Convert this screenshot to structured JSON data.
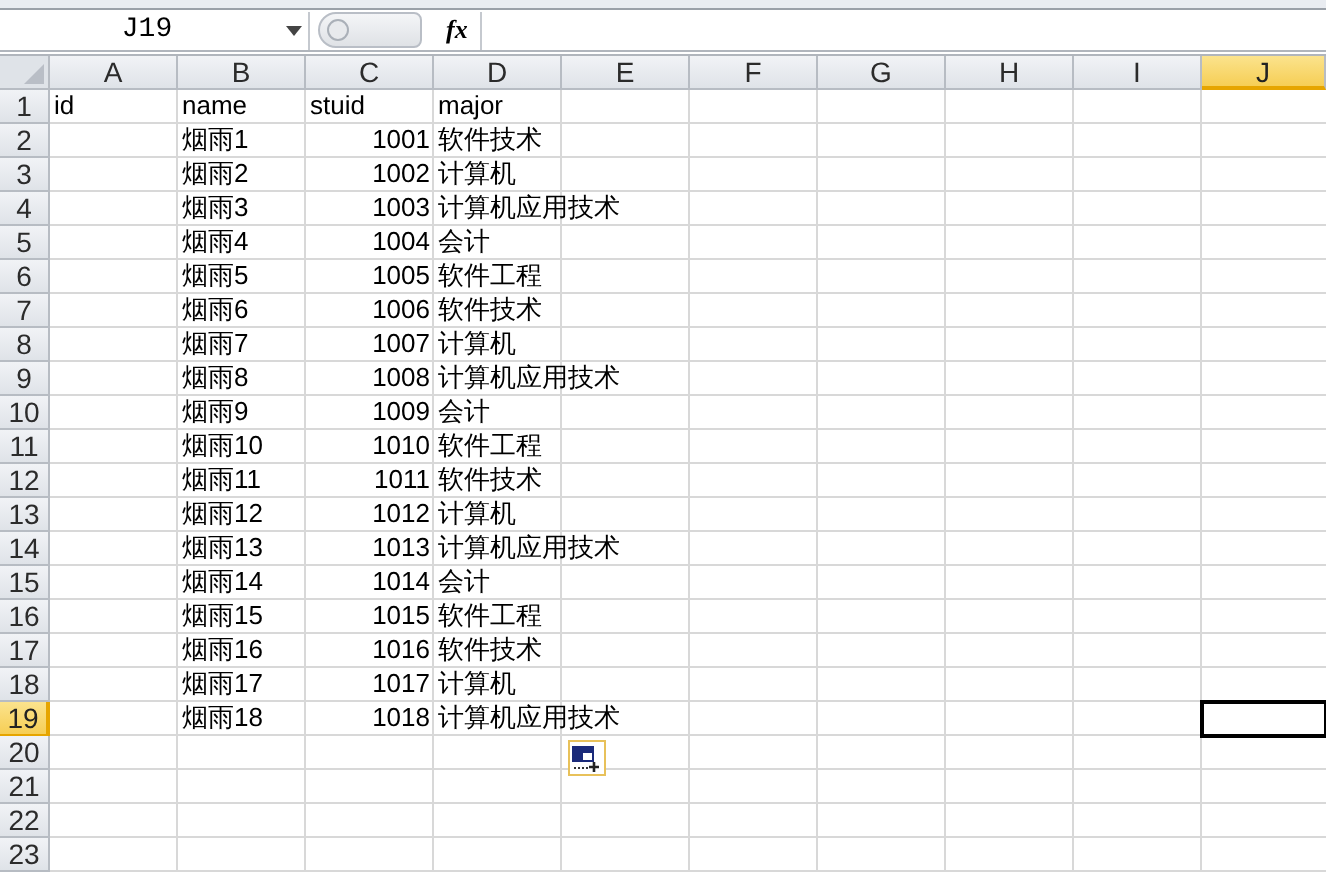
{
  "formula_bar": {
    "name_box": "J19",
    "function_button": "fx"
  },
  "columns": [
    {
      "label": "A",
      "selected": false
    },
    {
      "label": "B",
      "selected": false
    },
    {
      "label": "C",
      "selected": false
    },
    {
      "label": "D",
      "selected": false
    },
    {
      "label": "E",
      "selected": false
    },
    {
      "label": "F",
      "selected": false
    },
    {
      "label": "G",
      "selected": false
    },
    {
      "label": "H",
      "selected": false
    },
    {
      "label": "I",
      "selected": false
    },
    {
      "label": "J",
      "selected": true
    }
  ],
  "rows": [
    {
      "number": "1",
      "selected": false,
      "cells": [
        {
          "text": "id",
          "kind": "text"
        },
        {
          "text": "name",
          "kind": "text"
        },
        {
          "text": "stuid",
          "kind": "text"
        },
        {
          "text": "major",
          "kind": "text"
        }
      ]
    },
    {
      "number": "2",
      "selected": false,
      "cells": [
        null,
        {
          "text": "烟雨1",
          "kind": "text"
        },
        {
          "text": "1001",
          "kind": "number"
        },
        {
          "text": "软件技术",
          "kind": "text"
        }
      ]
    },
    {
      "number": "3",
      "selected": false,
      "cells": [
        null,
        {
          "text": "烟雨2",
          "kind": "text"
        },
        {
          "text": "1002",
          "kind": "number"
        },
        {
          "text": "计算机",
          "kind": "text"
        }
      ]
    },
    {
      "number": "4",
      "selected": false,
      "cells": [
        null,
        {
          "text": "烟雨3",
          "kind": "text"
        },
        {
          "text": "1003",
          "kind": "number"
        },
        {
          "text": "计算机应用技术",
          "kind": "text"
        }
      ]
    },
    {
      "number": "5",
      "selected": false,
      "cells": [
        null,
        {
          "text": "烟雨4",
          "kind": "text"
        },
        {
          "text": "1004",
          "kind": "number"
        },
        {
          "text": "会计",
          "kind": "text"
        }
      ]
    },
    {
      "number": "6",
      "selected": false,
      "cells": [
        null,
        {
          "text": "烟雨5",
          "kind": "text"
        },
        {
          "text": "1005",
          "kind": "number"
        },
        {
          "text": "软件工程",
          "kind": "text"
        }
      ]
    },
    {
      "number": "7",
      "selected": false,
      "cells": [
        null,
        {
          "text": "烟雨6",
          "kind": "text"
        },
        {
          "text": "1006",
          "kind": "number"
        },
        {
          "text": "软件技术",
          "kind": "text"
        }
      ]
    },
    {
      "number": "8",
      "selected": false,
      "cells": [
        null,
        {
          "text": "烟雨7",
          "kind": "text"
        },
        {
          "text": "1007",
          "kind": "number"
        },
        {
          "text": "计算机",
          "kind": "text"
        }
      ]
    },
    {
      "number": "9",
      "selected": false,
      "cells": [
        null,
        {
          "text": "烟雨8",
          "kind": "text"
        },
        {
          "text": "1008",
          "kind": "number"
        },
        {
          "text": "计算机应用技术",
          "kind": "text"
        }
      ]
    },
    {
      "number": "10",
      "selected": false,
      "cells": [
        null,
        {
          "text": "烟雨9",
          "kind": "text"
        },
        {
          "text": "1009",
          "kind": "number"
        },
        {
          "text": "会计",
          "kind": "text"
        }
      ]
    },
    {
      "number": "11",
      "selected": false,
      "cells": [
        null,
        {
          "text": "烟雨10",
          "kind": "text"
        },
        {
          "text": "1010",
          "kind": "number"
        },
        {
          "text": "软件工程",
          "kind": "text"
        }
      ]
    },
    {
      "number": "12",
      "selected": false,
      "cells": [
        null,
        {
          "text": "烟雨11",
          "kind": "text"
        },
        {
          "text": "1011",
          "kind": "number"
        },
        {
          "text": "软件技术",
          "kind": "text"
        }
      ]
    },
    {
      "number": "13",
      "selected": false,
      "cells": [
        null,
        {
          "text": "烟雨12",
          "kind": "text"
        },
        {
          "text": "1012",
          "kind": "number"
        },
        {
          "text": "计算机",
          "kind": "text"
        }
      ]
    },
    {
      "number": "14",
      "selected": false,
      "cells": [
        null,
        {
          "text": "烟雨13",
          "kind": "text"
        },
        {
          "text": "1013",
          "kind": "number"
        },
        {
          "text": "计算机应用技术",
          "kind": "text"
        }
      ]
    },
    {
      "number": "15",
      "selected": false,
      "cells": [
        null,
        {
          "text": "烟雨14",
          "kind": "text"
        },
        {
          "text": "1014",
          "kind": "number"
        },
        {
          "text": "会计",
          "kind": "text"
        }
      ]
    },
    {
      "number": "16",
      "selected": false,
      "cells": [
        null,
        {
          "text": "烟雨15",
          "kind": "text"
        },
        {
          "text": "1015",
          "kind": "number"
        },
        {
          "text": "软件工程",
          "kind": "text"
        }
      ]
    },
    {
      "number": "17",
      "selected": false,
      "cells": [
        null,
        {
          "text": "烟雨16",
          "kind": "text"
        },
        {
          "text": "1016",
          "kind": "number"
        },
        {
          "text": "软件技术",
          "kind": "text"
        }
      ]
    },
    {
      "number": "18",
      "selected": false,
      "cells": [
        null,
        {
          "text": "烟雨17",
          "kind": "text"
        },
        {
          "text": "1017",
          "kind": "number"
        },
        {
          "text": "计算机",
          "kind": "text"
        }
      ]
    },
    {
      "number": "19",
      "selected": true,
      "cells": [
        null,
        {
          "text": "烟雨18",
          "kind": "text"
        },
        {
          "text": "1018",
          "kind": "number"
        },
        {
          "text": "计算机应用技术",
          "kind": "text"
        }
      ]
    },
    {
      "number": "20",
      "selected": false,
      "cells": []
    },
    {
      "number": "21",
      "selected": false,
      "cells": []
    },
    {
      "number": "22",
      "selected": false,
      "cells": []
    },
    {
      "number": "23",
      "selected": false,
      "cells": []
    }
  ],
  "paste_options_button": true
}
